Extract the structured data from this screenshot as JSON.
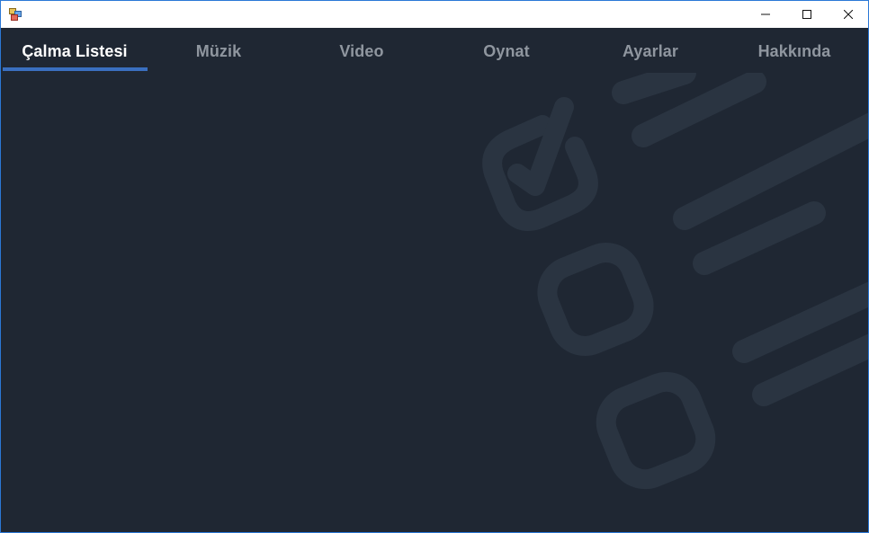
{
  "window": {
    "icon": "winforms-app-icon",
    "controls": {
      "minimize_icon": "minimize-icon",
      "maximize_icon": "maximize-icon",
      "close_icon": "close-icon"
    }
  },
  "tabs": [
    {
      "label": "Çalma Listesi",
      "active": true
    },
    {
      "label": "Müzik",
      "active": false
    },
    {
      "label": "Video",
      "active": false
    },
    {
      "label": "Oynat",
      "active": false
    },
    {
      "label": "Ayarlar",
      "active": false
    },
    {
      "label": "Hakkında",
      "active": false
    }
  ],
  "colors": {
    "background": "#1f2733",
    "active_tab_text": "#ffffff",
    "inactive_tab_text": "#8f969f",
    "accent": "#3a6fc0",
    "watermark": "#2a3441"
  },
  "background_art": {
    "icon": "checklist-watermark-icon"
  }
}
